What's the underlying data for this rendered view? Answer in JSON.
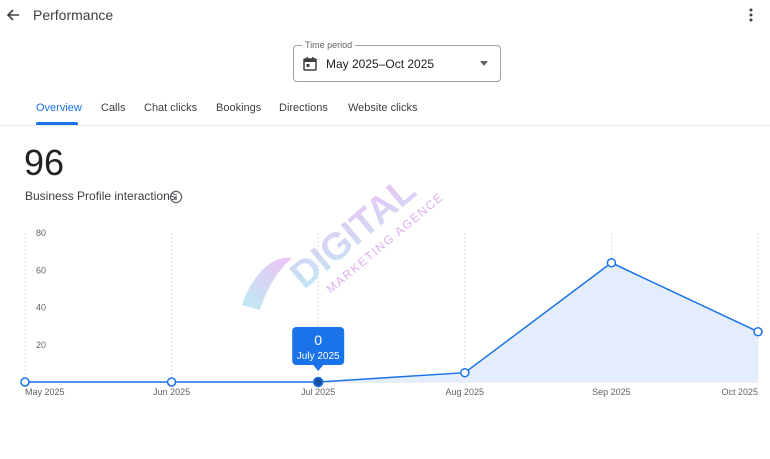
{
  "header": {
    "title": "Performance",
    "back_icon": "arrow-left-icon",
    "menu_icon": "more-vert-icon"
  },
  "time_period": {
    "label": "Time period",
    "value": "May 2025–Oct 2025",
    "icon": "calendar-icon"
  },
  "tabs": [
    {
      "label": "Overview",
      "active": true
    },
    {
      "label": "Calls",
      "active": false
    },
    {
      "label": "Chat clicks",
      "active": false
    },
    {
      "label": "Bookings",
      "active": false
    },
    {
      "label": "Directions",
      "active": false
    },
    {
      "label": "Website clicks",
      "active": false
    }
  ],
  "metric": {
    "value": "96",
    "label": "Business Profile interactions",
    "info_icon": "info-icon"
  },
  "watermark": {
    "line1": "DIGITAL",
    "line2": "MARKETING AGENCE"
  },
  "colors": {
    "accent": "#1a73e8",
    "line": "#1a73e8",
    "area": "#e3edfc",
    "tooltip": "#1a73e8"
  },
  "chart_data": {
    "type": "area",
    "categories": [
      "May 2025",
      "Jun 2025",
      "Jul 2025",
      "Aug 2025",
      "Sep 2025",
      "Oct 2025"
    ],
    "values": [
      0,
      0,
      0,
      5,
      64,
      27
    ],
    "yticks": [
      20,
      40,
      60,
      80
    ],
    "ylim": [
      0,
      80
    ],
    "grid": "vertical",
    "tooltip": {
      "index": 2,
      "value": "0",
      "label": "July 2025"
    }
  }
}
